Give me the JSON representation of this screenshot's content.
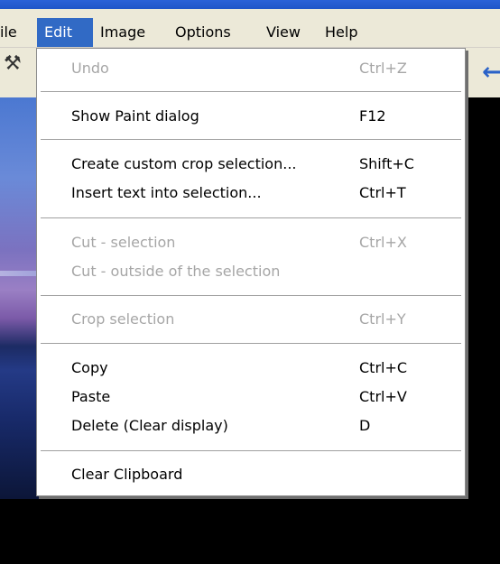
{
  "menubar": {
    "items": [
      {
        "label": "ile"
      },
      {
        "label": "Edit",
        "active": true
      },
      {
        "label": "Image"
      },
      {
        "label": "Options"
      },
      {
        "label": "View"
      },
      {
        "label": "Help"
      }
    ]
  },
  "toolbar": {
    "icons": [
      "paint-icon"
    ],
    "arrow": "back-arrow-icon"
  },
  "edit_menu": {
    "undo": {
      "label": "Undo",
      "shortcut": "Ctrl+Z",
      "enabled": false
    },
    "show_paint": {
      "label": "Show Paint dialog",
      "shortcut": "F12",
      "enabled": true
    },
    "create_crop": {
      "label": "Create custom crop selection...",
      "shortcut": "Shift+C",
      "enabled": true
    },
    "insert_text": {
      "label": "Insert text into selection...",
      "shortcut": "Ctrl+T",
      "enabled": true
    },
    "cut_selection": {
      "label": "Cut - selection",
      "shortcut": "Ctrl+X",
      "enabled": false
    },
    "cut_outside": {
      "label": "Cut - outside of the selection",
      "shortcut": "",
      "enabled": false
    },
    "crop_selection": {
      "label": "Crop selection",
      "shortcut": "Ctrl+Y",
      "enabled": false
    },
    "copy": {
      "label": "Copy",
      "shortcut": "Ctrl+C",
      "enabled": true
    },
    "paste": {
      "label": "Paste",
      "shortcut": "Ctrl+V",
      "enabled": true
    },
    "delete": {
      "label": "Delete (Clear display)",
      "shortcut": "D",
      "enabled": true
    },
    "clear_clipboard": {
      "label": "Clear Clipboard",
      "shortcut": "",
      "enabled": true
    }
  },
  "colors": {
    "menu_highlight": "#316ac5",
    "disabled_text": "#a6a6a6",
    "menubar_bg": "#ece9d8"
  }
}
